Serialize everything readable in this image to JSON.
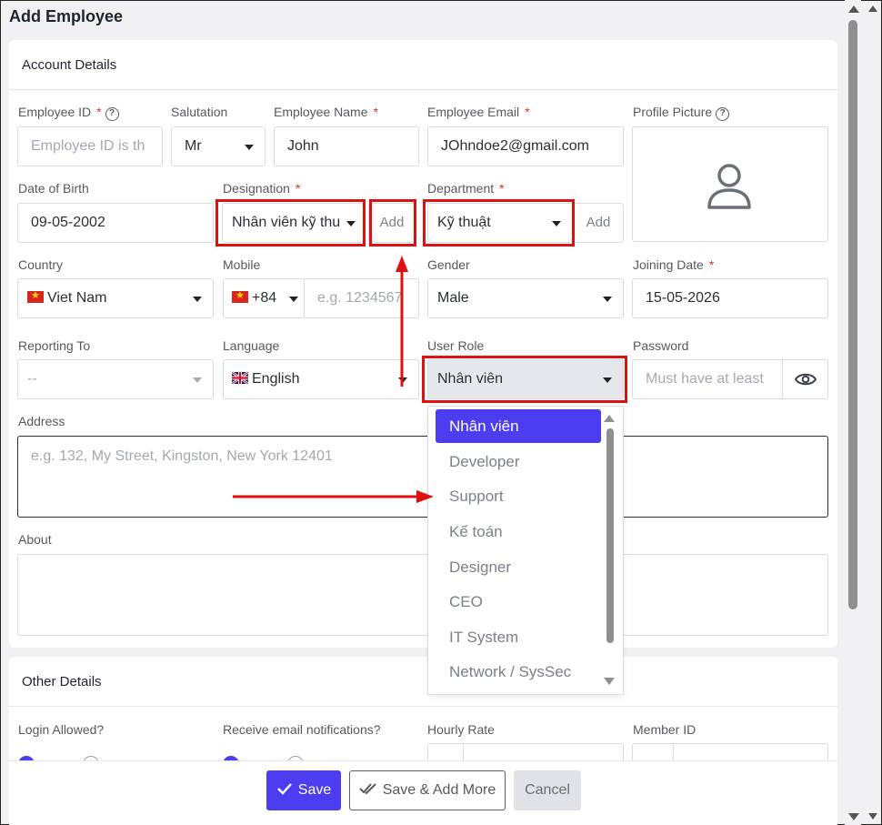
{
  "page": {
    "title": "Add Employee"
  },
  "account": {
    "title": "Account Details",
    "employee_id": {
      "label": "Employee ID",
      "placeholder": "Employee ID is th"
    },
    "salutation": {
      "label": "Salutation",
      "value": "Mr"
    },
    "employee_name": {
      "label": "Employee Name",
      "value": "John"
    },
    "employee_email": {
      "label": "Employee Email",
      "value": "JOhndoe2@gmail.com"
    },
    "profile_picture": {
      "label": "Profile Picture"
    },
    "dob": {
      "label": "Date of Birth",
      "value": "09-05-2002"
    },
    "designation": {
      "label": "Designation",
      "value": "Nhân viên kỹ thu",
      "add": "Add"
    },
    "department": {
      "label": "Department",
      "value": "Kỹ thuật",
      "add": "Add"
    },
    "country": {
      "label": "Country",
      "value": "Viet Nam"
    },
    "mobile": {
      "label": "Mobile",
      "code": "+84",
      "placeholder": "e.g. 1234567"
    },
    "gender": {
      "label": "Gender",
      "value": "Male"
    },
    "joining_date": {
      "label": "Joining Date",
      "value": "15-05-2026"
    },
    "reporting_to": {
      "label": "Reporting To",
      "value": "--"
    },
    "language": {
      "label": "Language",
      "value": "English"
    },
    "user_role": {
      "label": "User Role",
      "value": "Nhân viên"
    },
    "password": {
      "label": "Password",
      "placeholder": "Must have at least"
    },
    "address": {
      "label": "Address",
      "placeholder": "e.g. 132, My Street, Kingston, New York 12401"
    },
    "about": {
      "label": "About"
    }
  },
  "role_dropdown": {
    "options": [
      "Nhân viên",
      "Developer",
      "Support",
      "Kế toán",
      "Designer",
      "CEO",
      "IT System",
      "Network / SysSec"
    ],
    "selected": "Nhân viên"
  },
  "other": {
    "title": "Other Details",
    "login_allowed": {
      "label": "Login Allowed?"
    },
    "email_notifications": {
      "label": "Receive email notifications?"
    },
    "hourly_rate": {
      "label": "Hourly Rate"
    },
    "member_id": {
      "label": "Member ID"
    }
  },
  "footer": {
    "save": "Save",
    "save_add_more": "Save & Add More",
    "cancel": "Cancel"
  },
  "colors": {
    "accent": "#4d3df0",
    "highlight": "#dd1111",
    "required": "#d92d2d"
  }
}
